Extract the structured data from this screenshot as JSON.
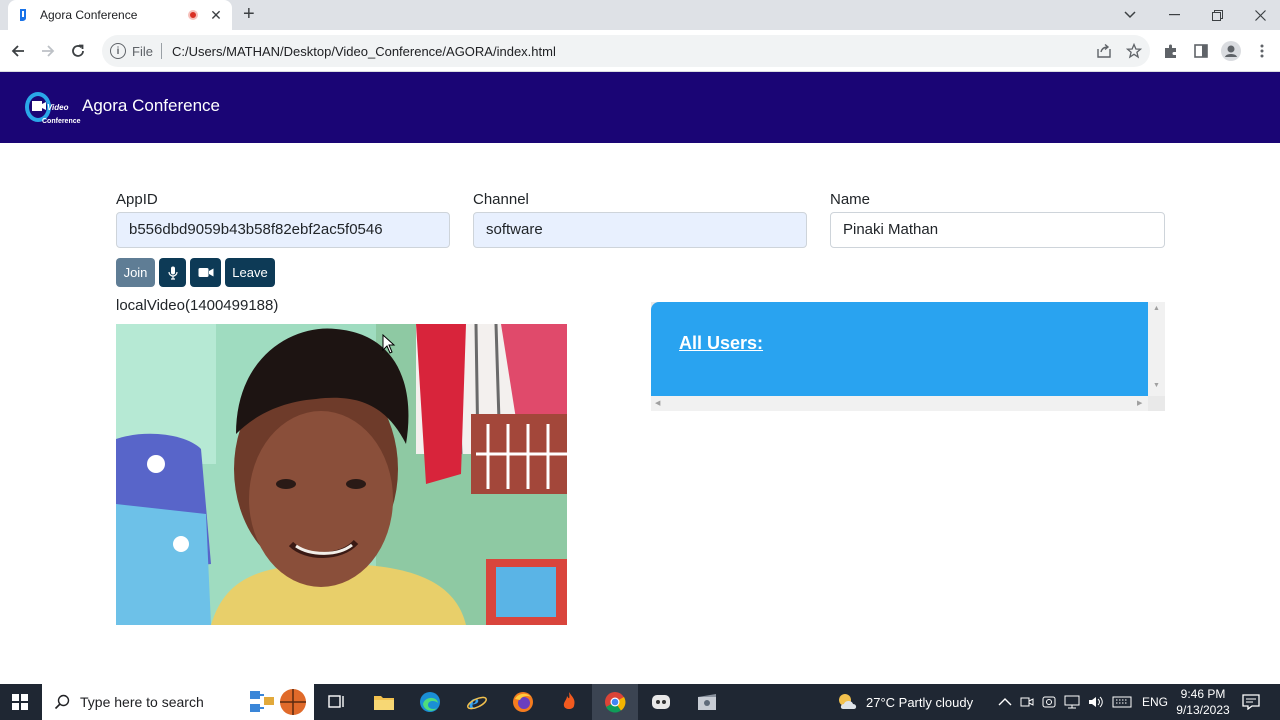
{
  "browser": {
    "tab_title": "Agora Conference",
    "tab_close": "✕",
    "new_tab": "+",
    "scheme": "File",
    "url": "C:/Users/MATHAN/Desktop/Video_Conference/AGORA/index.html"
  },
  "app": {
    "brand": "Agora Conference",
    "logo_text": "Video Conference"
  },
  "form": {
    "appid_label": "AppID",
    "appid_value": "b556dbd9059b43b58f82ebf2ac5f0546",
    "channel_label": "Channel",
    "channel_value": "software",
    "name_label": "Name",
    "name_value": "Pinaki Mathan"
  },
  "controls": {
    "join_label": "Join",
    "leave_label": "Leave",
    "mic_icon": "microphone-icon",
    "camera_icon": "video-camera-icon"
  },
  "video": {
    "local_caption": "localVideo(1400499188)"
  },
  "users_panel": {
    "title": "All Users:"
  },
  "taskbar": {
    "search_placeholder": "Type here to search",
    "weather": "27°C  Partly cloudy",
    "language": "ENG",
    "time": "9:46 PM",
    "date": "9/13/2023"
  },
  "colors": {
    "navbar": "#1a0575",
    "users_panel": "#29a3f0",
    "join_button": "#5f7d95",
    "control_button": "#0d3a56"
  }
}
